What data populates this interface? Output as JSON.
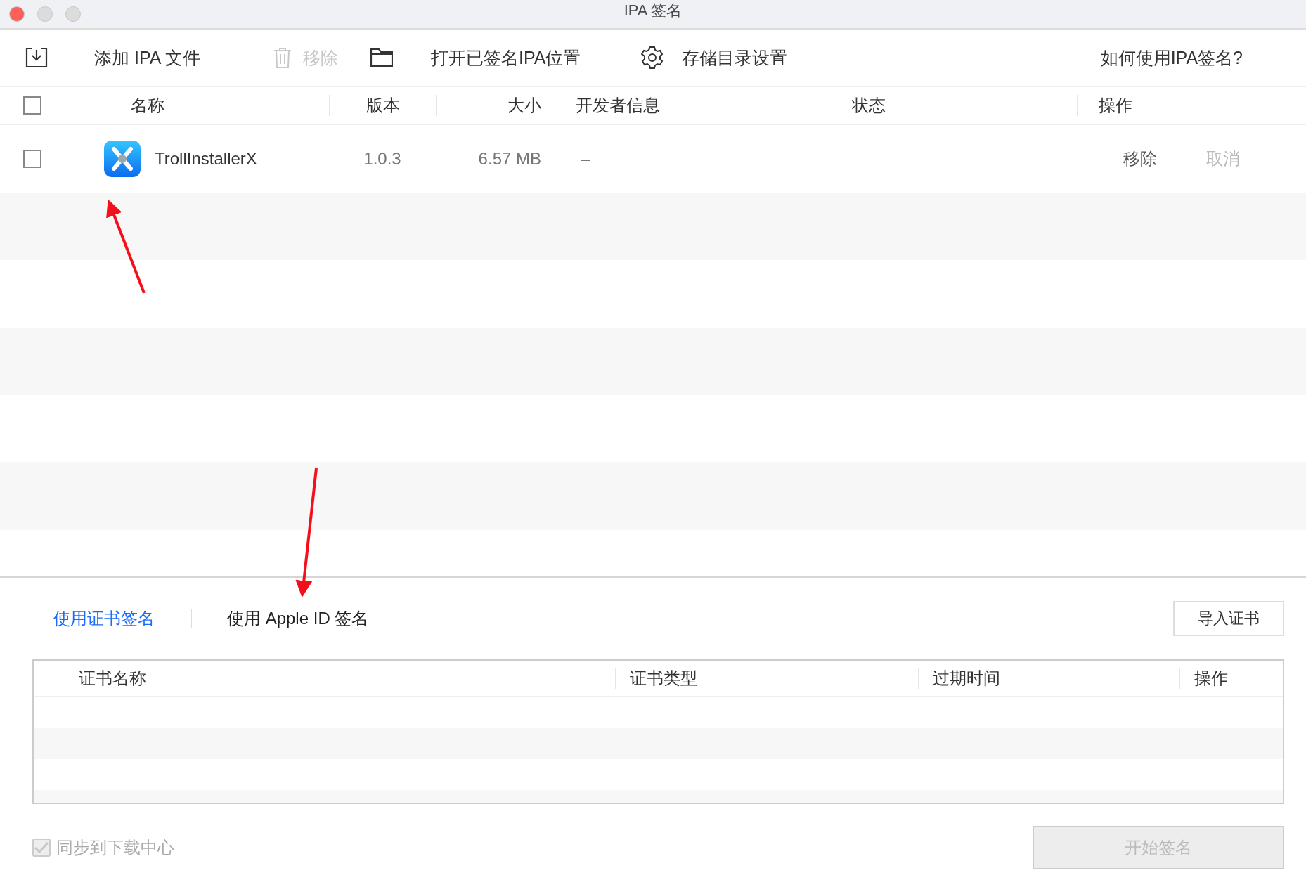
{
  "window": {
    "title": "IPA 签名"
  },
  "toolbar": [
    {
      "kind": "add",
      "label": "添加 IPA 文件",
      "disabled": false
    },
    {
      "kind": "remove",
      "label": "移除",
      "disabled": true
    },
    {
      "kind": "folder",
      "label": "打开已签名IPA位置",
      "disabled": false
    },
    {
      "kind": "settings",
      "label": "存储目录设置",
      "disabled": false
    }
  ],
  "help_link": "如何使用IPA签名?",
  "table": {
    "all_checked": false,
    "columns": [
      "名称",
      "版本",
      "大小",
      "开发者信息",
      "状态",
      "操作"
    ],
    "rows": [
      {
        "checked": false,
        "name": "TrollInstallerX",
        "version": "1.0.3",
        "size": "6.57 MB",
        "developer": "–",
        "actions": [
          {
            "label": "移除",
            "disabled": false
          },
          {
            "label": "取消",
            "disabled": true
          }
        ]
      }
    ]
  },
  "sign_tabs": [
    {
      "label": "使用证书签名",
      "selected": true
    },
    {
      "label": "使用 Apple ID 签名",
      "selected": false
    }
  ],
  "import_button": "导入证书",
  "cert_table": {
    "columns": [
      "证书名称",
      "证书类型",
      "过期时间",
      "操作"
    ]
  },
  "sync": {
    "label": "同步到下载中心",
    "checked": true,
    "disabled": true
  },
  "start_button": {
    "label": "开始签名",
    "disabled": true
  }
}
